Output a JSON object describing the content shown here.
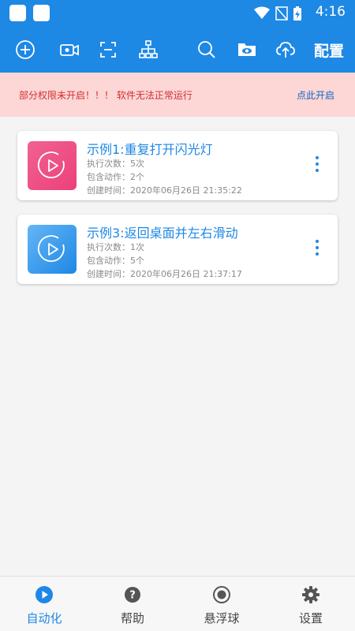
{
  "status_bar": {
    "time": "4:16"
  },
  "toolbar": {
    "buttons": [
      "add-icon",
      "record-icon",
      "scan-icon",
      "sitemap-icon",
      "search-icon",
      "folder-view-icon",
      "cloud-upload-icon"
    ],
    "config_label": "配置"
  },
  "warning": {
    "text": "部分权限未开启！！！ 软件无法正常运行",
    "link": "点此开启"
  },
  "tasks": [
    {
      "title": "示例1:重复打开闪光灯",
      "exec_count": "执行次数：5次",
      "actions": "包含动作：2个",
      "created": "创建时间：2020年06月26日 21:35:22",
      "thumb_color": "#ec407a"
    },
    {
      "title": "示例3:返回桌面并左右滑动",
      "exec_count": "执行次数：1次",
      "actions": "包含动作：5个",
      "created": "创建时间：2020年06月26日 21:37:17",
      "thumb_color": "#1e88e5"
    }
  ],
  "bottom_nav": [
    {
      "label": "自动化",
      "icon": "play-circle-icon",
      "active": true
    },
    {
      "label": "帮助",
      "icon": "help-icon",
      "active": false
    },
    {
      "label": "悬浮球",
      "icon": "floating-ball-icon",
      "active": false
    },
    {
      "label": "设置",
      "icon": "gear-icon",
      "active": false
    }
  ],
  "colors": {
    "primary": "#1e88e5",
    "warning_bg": "#fdd6d6",
    "warning_text": "#d32f2f"
  }
}
